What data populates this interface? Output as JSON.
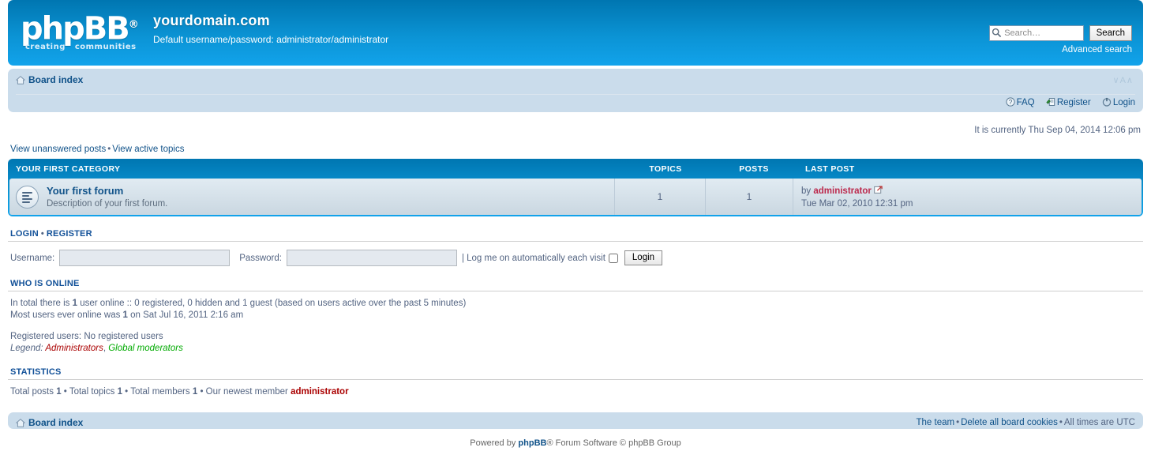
{
  "header": {
    "logo_text": "phpBB",
    "logo_reg": "®",
    "logo_tagline_left": "creating",
    "logo_tagline_right": "communities",
    "site_name": "yourdomain.com",
    "site_description": "Default username/password: administrator/administrator",
    "brand_color": "#12A3EB"
  },
  "search": {
    "placeholder": "Search…",
    "value": "",
    "button_label": "Search",
    "advanced_label": "Advanced search",
    "icon": "search-icon"
  },
  "navbar": {
    "breadcrumb_label": "Board index",
    "home_icon": "home-icon",
    "font_size_switch": "∨A∧",
    "links": [
      {
        "label": "FAQ",
        "icon": "faq-icon"
      },
      {
        "label": "Register",
        "icon": "register-icon"
      },
      {
        "label": "Login",
        "icon": "login-power-icon"
      }
    ]
  },
  "page": {
    "current_time": "It is currently Thu Sep 04, 2014 12:06 pm",
    "toplinks": [
      {
        "label": "View unanswered posts"
      },
      {
        "label": "View active topics"
      }
    ],
    "toplinks_separator": "•"
  },
  "forum_table": {
    "category_title": "Your first category",
    "columns": {
      "topics": "Topics",
      "posts": "Posts",
      "lastpost": "Last post"
    },
    "rows": [
      {
        "icon": "forum-read-icon",
        "title": "Your first forum",
        "description": "Description of your first forum.",
        "topics": "1",
        "posts": "1",
        "lastpost_by_prefix": "by",
        "lastpost_author": "administrator",
        "lastpost_goto_icon": "goto-last-post-icon",
        "lastpost_time": "Tue Mar 02, 2010 12:31 pm"
      }
    ]
  },
  "login_block": {
    "heading_login": "Login",
    "heading_separator": "•",
    "heading_register": "Register",
    "username_label": "Username:",
    "username_value": "",
    "password_label": "Password:",
    "password_value": "",
    "autologin_label": "| Log me on automatically each visit",
    "autologin_checked": false,
    "submit_label": "Login"
  },
  "who_is_online": {
    "heading": "Who is online",
    "line1_prefix": "In total there is ",
    "line1_count": "1",
    "line1_suffix": " user online :: 0 registered, 0 hidden and 1 guest (based on users active over the past 5 minutes)",
    "line2_prefix": "Most users ever online was ",
    "line2_count": "1",
    "line2_suffix": " on Sat Jul 16, 2011 2:16 am",
    "registered_users": "Registered users: No registered users",
    "legend_label": "Legend: ",
    "legend_admins": "Administrators",
    "legend_comma": ", ",
    "legend_mods": "Global moderators",
    "legend_admin_color": "#AA0000",
    "legend_mod_color": "#00AA00"
  },
  "statistics": {
    "heading": "Statistics",
    "total_posts_label": "Total posts",
    "total_posts_value": "1",
    "total_topics_label": "Total topics",
    "total_topics_value": "1",
    "total_members_label": "Total members",
    "total_members_value": "1",
    "newest_member_label": "Our newest member",
    "newest_member_value": "administrator",
    "separator": "•"
  },
  "footer": {
    "breadcrumb_label": "Board index",
    "home_icon": "home-icon",
    "links": [
      {
        "label": "The team"
      },
      {
        "label": "Delete all board cookies"
      }
    ],
    "timezone": "All times are UTC",
    "separator": "•",
    "copyright_prefix": "Powered by ",
    "copyright_brand": "phpBB",
    "copyright_suffix": "® Forum Software © phpBB Group"
  }
}
